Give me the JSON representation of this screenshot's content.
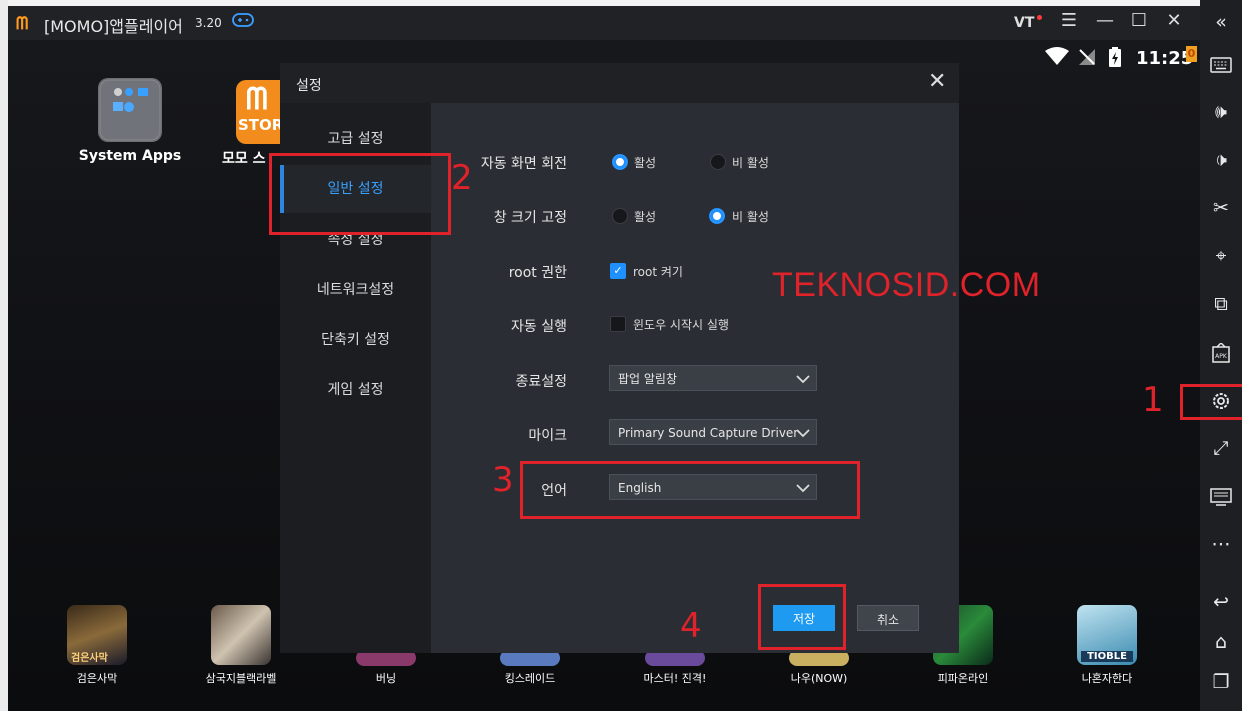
{
  "window": {
    "title": "[MOMO]앱플레이어",
    "version": "3.20",
    "vt_label": "VT",
    "controls": [
      "menu-icon",
      "minimize-icon",
      "maximize-icon",
      "close-icon"
    ]
  },
  "status_bar": {
    "time": "11:25",
    "badge": "0"
  },
  "desktop": {
    "apps": [
      {
        "label": "System Apps"
      },
      {
        "label": "모모 스",
        "tile_text": "STOR"
      }
    ],
    "games": [
      {
        "label": "검은사막",
        "thumb_text": "검은사막"
      },
      {
        "label": "삼국지블랙라벨"
      },
      {
        "label": "버닝"
      },
      {
        "label": "킹스레이드"
      },
      {
        "label": "마스터! 진격!"
      },
      {
        "label": "나우(NOW)"
      },
      {
        "label": "피파온라인"
      },
      {
        "label": "나혼자한다",
        "thumb_text": "TIOBLE"
      }
    ]
  },
  "dialog": {
    "title": "설정",
    "nav": [
      "고급 설정",
      "일반 설정",
      "속성 설정",
      "네트워크설정",
      "단축키 설정",
      "게임 설정"
    ],
    "rows": {
      "rotate": {
        "label": "자동 화면 회전",
        "on": "활성",
        "off": "비 활성",
        "selected": "on"
      },
      "fix_size": {
        "label": "창 크기 고정",
        "on": "활성",
        "off": "비 활성",
        "selected": "off"
      },
      "root": {
        "label": "root 권한",
        "option": "root 켜기",
        "checked": true
      },
      "autorun": {
        "label": "자동 실행",
        "option": "윈도우 시작시 실행",
        "checked": false
      },
      "exit": {
        "label": "종료설정",
        "value": "팝업 알림창"
      },
      "mic": {
        "label": "마이크",
        "value": "Primary Sound Capture Driver"
      },
      "language": {
        "label": "언어",
        "value": "English"
      }
    },
    "save_label": "저장",
    "cancel_label": "취소"
  },
  "annotations": {
    "watermark": "TEKNOSID.COM",
    "steps": [
      "1",
      "2",
      "3",
      "4"
    ],
    "color": "#e0222a"
  },
  "sidebar": {
    "icons": [
      "collapse-icon",
      "keyboard-icon",
      "volume-up-icon",
      "volume-down-icon",
      "scissors-icon",
      "location-icon",
      "multi-instance-icon",
      "apk-install-icon",
      "settings-icon",
      "fullscreen-icon",
      "screen-icon",
      "more-icon",
      "back-icon",
      "home-icon",
      "recents-icon"
    ]
  }
}
